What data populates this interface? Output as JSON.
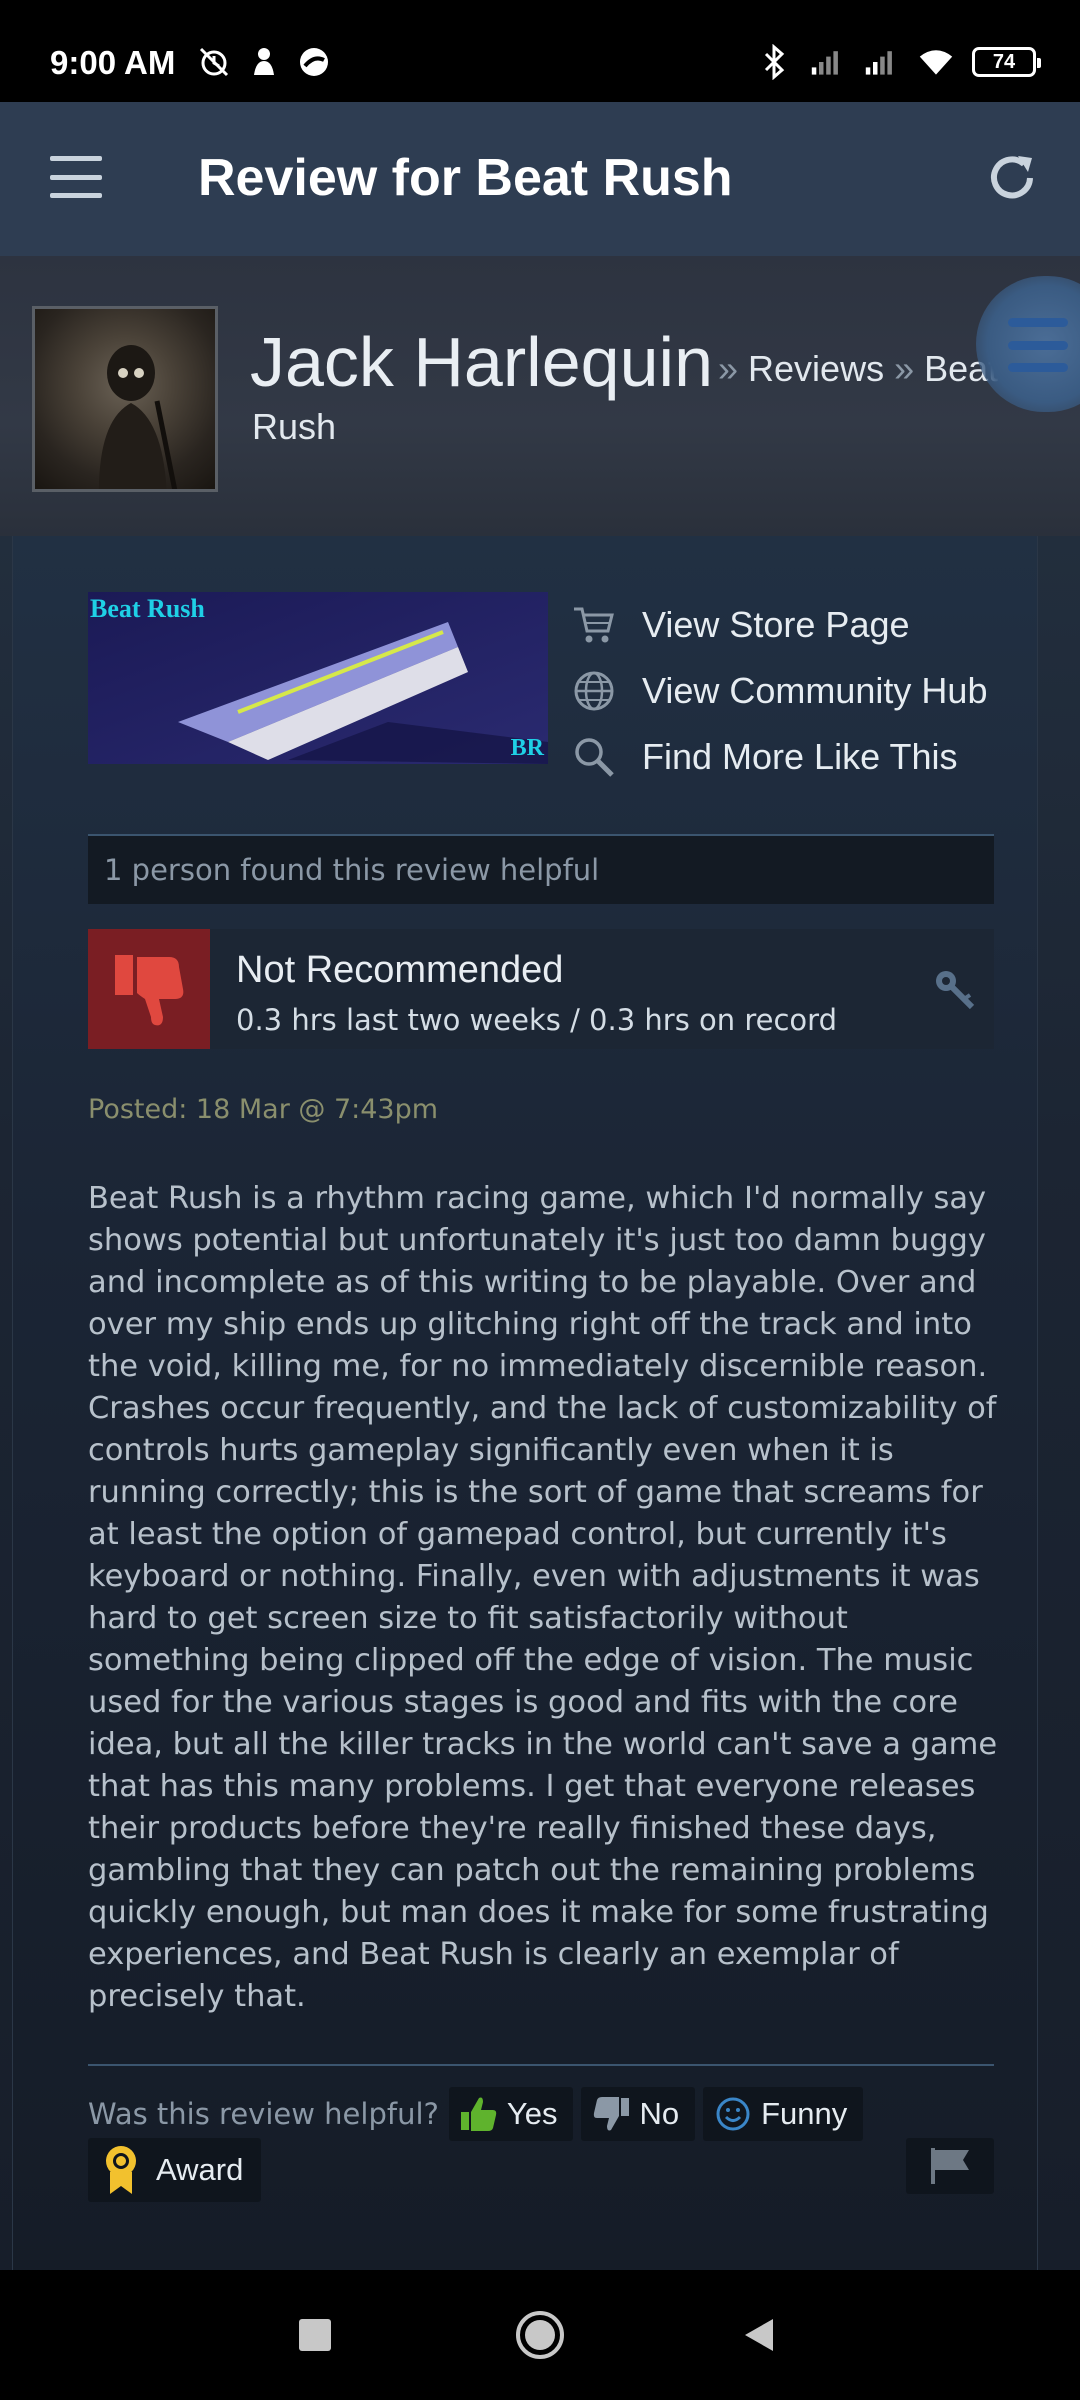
{
  "status_bar": {
    "time": "9:00 AM",
    "battery": "74",
    "icons_left": [
      "alarm-off-icon",
      "notification-icon",
      "app-icon"
    ],
    "icons_right": [
      "bluetooth-icon",
      "signal-icon",
      "signal-icon",
      "wifi-icon",
      "battery-icon"
    ]
  },
  "app_header": {
    "title": "Review for Beat Rush",
    "menu_icon": "hamburger-menu-icon",
    "refresh_icon": "refresh-icon"
  },
  "profile": {
    "name": "Jack Harlequin",
    "breadcrumb_sep": "»",
    "breadcrumb_reviews": "Reviews",
    "breadcrumb_game_part1": "Beat",
    "breadcrumb_game_part2": "Rush"
  },
  "game": {
    "capsule_title": "Beat Rush",
    "capsule_badge": "BR",
    "links": [
      {
        "label": "View Store Page",
        "icon": "cart-icon"
      },
      {
        "label": "View Community Hub",
        "icon": "globe-icon"
      },
      {
        "label": "Find More Like This",
        "icon": "search-icon"
      }
    ]
  },
  "review": {
    "helpful_count": "1 person found this review helpful",
    "verdict": "Not Recommended",
    "hours": "0.3 hrs last two weeks / 0.3 hrs on record",
    "posted": "Posted: 18 Mar @ 7:43pm",
    "text": "Beat Rush is a rhythm racing game, which I'd normally say shows potential but unfortunately it's just too damn buggy and incomplete as of this writing to be playable. Over and over my ship ends up glitching right off the track and into the void, killing me, for no immediately discernible reason. Crashes occur frequently, and the lack of customizability of controls hurts gameplay significantly even when it is running correctly; this is the sort of game that screams for at least the option of gamepad control, but currently it's keyboard or nothing. Finally, even with adjustments it was hard to get screen size to fit satisfactorily without something being clipped off the edge of vision. The music used for the various stages is good and fits with the core idea, but all the killer tracks in the world can't save a game that has this many problems. I get that everyone releases their products before they're really finished these days, gambling that they can patch out the remaining problems quickly enough, but man does it make for some frustrating experiences, and Beat Rush is clearly an exemplar of precisely that."
  },
  "feedback": {
    "question": "Was this review helpful?",
    "yes": "Yes",
    "no": "No",
    "funny": "Funny",
    "award": "Award"
  },
  "colors": {
    "header_bg": "#2e3d52",
    "thumb_down_bg": "#7a1e23",
    "thumb_red": "#e0483f",
    "yes_green": "#5fb32d",
    "award_gold": "#f2c12e",
    "posted_color": "#8a8f6d"
  }
}
